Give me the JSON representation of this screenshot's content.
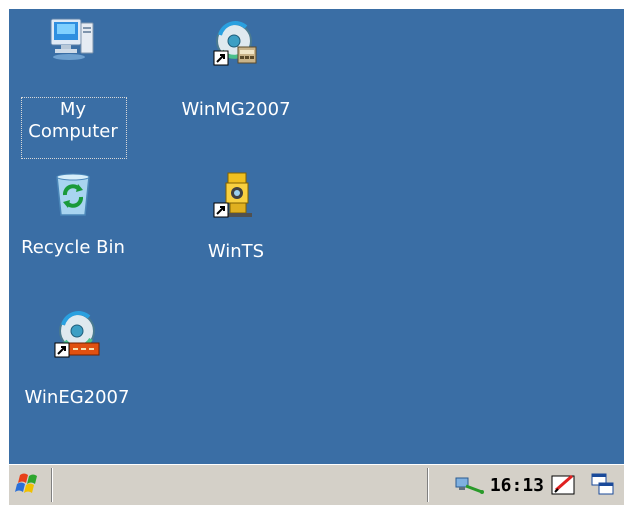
{
  "desktop": {
    "background_color": "#3a6ea5",
    "icons": [
      {
        "name": "My Computer",
        "line1": "My",
        "line2": "Computer",
        "icon": "computer-icon"
      },
      {
        "name": "WinMG2007",
        "icon": "winmg2007-icon"
      },
      {
        "name": "Recycle Bin",
        "icon": "recycle-bin-icon"
      },
      {
        "name": "WinTS",
        "icon": "total-station-icon"
      },
      {
        "name": "WinEG2007",
        "icon": "wineg2007-icon"
      }
    ]
  },
  "taskbar": {
    "start_icon": "windows-flag-icon",
    "clock": "16:13",
    "tray_icons": [
      "network-icon",
      "input-panel-icon",
      "desktop-switch-icon"
    ]
  }
}
